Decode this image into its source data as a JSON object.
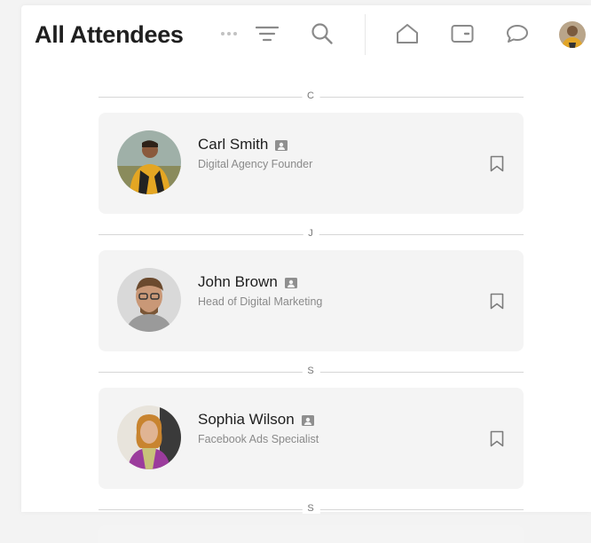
{
  "header": {
    "title": "All Attendees",
    "icons": [
      "more-dots-icon",
      "filter-icon",
      "search-icon",
      "home-icon",
      "wallet-icon",
      "chat-icon"
    ]
  },
  "sections": [
    {
      "letter": "C",
      "attendee": {
        "name": "Carl Smith",
        "role": "Digital Agency Founder"
      }
    },
    {
      "letter": "J",
      "attendee": {
        "name": "John Brown",
        "role": "Head of Digital Marketing"
      }
    },
    {
      "letter": "S",
      "attendee": {
        "name": "Sophia Wilson",
        "role": "Facebook Ads Specialist"
      }
    },
    {
      "letter": "S"
    }
  ],
  "colors": {
    "accent_text": "#1f1f1f",
    "icon_gray": "#8a8a8a",
    "card_bg": "#f4f4f4"
  }
}
